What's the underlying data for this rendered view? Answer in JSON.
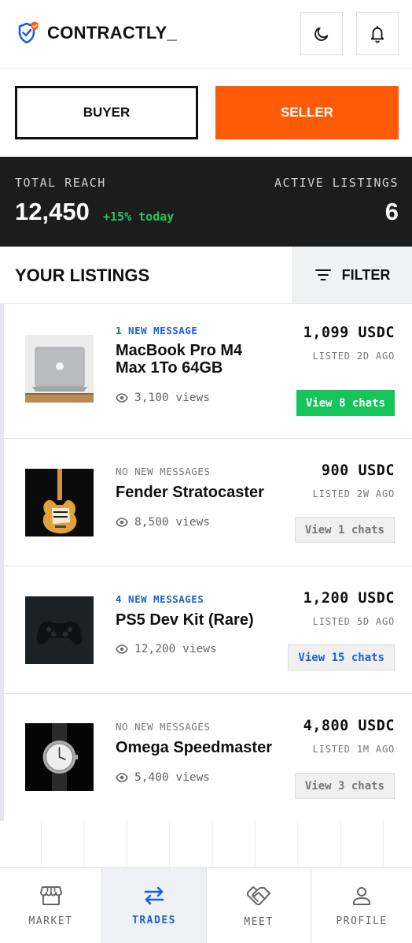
{
  "header": {
    "brand": "CONTRACTLY_",
    "icons": [
      "shield-logo-icon",
      "moon-icon",
      "bell-icon"
    ]
  },
  "roles": {
    "buyer": "BUYER",
    "seller": "SELLER",
    "active": "seller"
  },
  "stats": {
    "total_reach_label": "TOTAL REACH",
    "total_reach_value": "12,450",
    "total_reach_delta": "+15% today",
    "active_listings_label": "ACTIVE LISTINGS",
    "active_listings_value": "6"
  },
  "listings_section": {
    "title": "YOUR LISTINGS",
    "filter_label": "FILTER"
  },
  "listings": [
    {
      "message": "1 NEW MESSAGE",
      "has_new": true,
      "title": "MacBook Pro M4 Max 1To 64GB",
      "views": "3,100 views",
      "price": "1,099 USDC",
      "listed": "LISTED 2D AGO",
      "chats": "View 8 chats",
      "chat_style": "green"
    },
    {
      "message": "NO NEW MESSAGES",
      "has_new": false,
      "title": "Fender Stratocaster",
      "views": "8,500 views",
      "price": "900 USDC",
      "listed": "LISTED 2W AGO",
      "chats": "View 1 chats",
      "chat_style": "grey"
    },
    {
      "message": "4 NEW MESSAGES",
      "has_new": true,
      "title": "PS5 Dev Kit (Rare)",
      "views": "12,200 views",
      "price": "1,200 USDC",
      "listed": "LISTED 5D AGO",
      "chats": "View 15 chats",
      "chat_style": "blue"
    },
    {
      "message": "NO NEW MESSAGES",
      "has_new": false,
      "title": "Omega Speedmaster",
      "views": "5,400 views",
      "price": "4,800 USDC",
      "listed": "LISTED 1M AGO",
      "chats": "View 3 chats",
      "chat_style": "grey"
    }
  ],
  "bottom_nav": [
    {
      "label": "MARKET",
      "icon": "store-icon",
      "active": false
    },
    {
      "label": "TRADES",
      "icon": "swap-arrows-icon",
      "active": true
    },
    {
      "label": "MEET",
      "icon": "handshake-icon",
      "active": false
    },
    {
      "label": "PROFILE",
      "icon": "user-icon",
      "active": false
    }
  ],
  "colors": {
    "accent": "#ff5a06",
    "success": "#16c45a",
    "link": "#1b5fd6",
    "dark": "#1c1c1c"
  }
}
